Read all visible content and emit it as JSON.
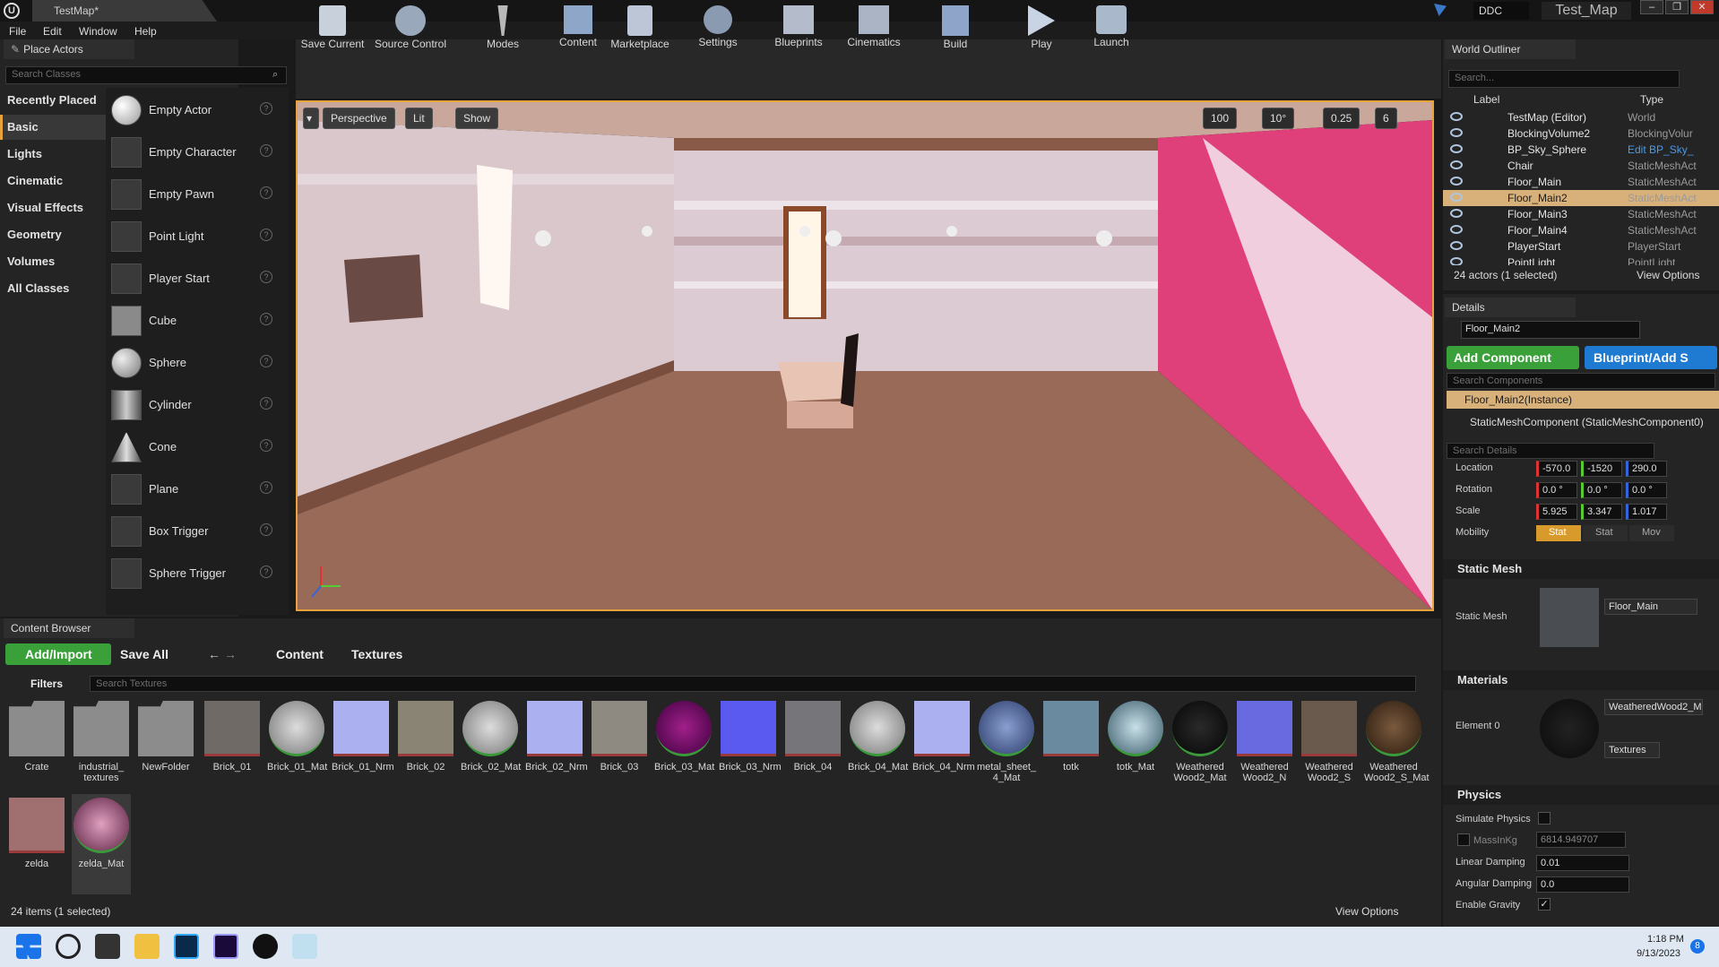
{
  "window": {
    "doc_tab": "TestMap*",
    "ddc_label": "DDC",
    "map_name": "Test_Map",
    "menus": [
      "File",
      "Edit",
      "Window",
      "Help"
    ]
  },
  "place_actors": {
    "tab_title": "Place Actors",
    "search_placeholder": "Search Classes",
    "categories": [
      "Recently Placed",
      "Basic",
      "Lights",
      "Cinematic",
      "Visual Effects",
      "Geometry",
      "Volumes",
      "All Classes"
    ],
    "selected_category": "Basic",
    "actors": [
      "Empty Actor",
      "Empty Character",
      "Empty Pawn",
      "Point Light",
      "Player Start",
      "Cube",
      "Sphere",
      "Cylinder",
      "Cone",
      "Plane",
      "Box Trigger",
      "Sphere Trigger"
    ]
  },
  "toolbar": {
    "buttons": [
      "Save Current",
      "Source Control",
      "Modes",
      "Content",
      "Marketplace",
      "Settings",
      "Blueprints",
      "Cinematics",
      "Build",
      "Play",
      "Launch"
    ]
  },
  "viewport": {
    "perspective": "Perspective",
    "lit": "Lit",
    "show": "Show",
    "grid_snap": "100",
    "rot_snap": "10°",
    "scale_snap": "0.25",
    "camera_speed": "6"
  },
  "outliner": {
    "tab_title": "World Outliner",
    "search_placeholder": "Search...",
    "col_label": "Label",
    "col_type": "Type",
    "rows": [
      {
        "name": "TestMap (Editor)",
        "type": "World"
      },
      {
        "name": "BlockingVolume2",
        "type": "BlockingVolur"
      },
      {
        "name": "BP_Sky_Sphere",
        "type": "Edit BP_Sky_"
      },
      {
        "name": "Chair",
        "type": "StaticMeshAct"
      },
      {
        "name": "Floor_Main",
        "type": "StaticMeshAct"
      },
      {
        "name": "Floor_Main2",
        "type": "StaticMeshAct"
      },
      {
        "name": "Floor_Main3",
        "type": "StaticMeshAct"
      },
      {
        "name": "Floor_Main4",
        "type": "StaticMeshAct"
      },
      {
        "name": "PlayerStart",
        "type": "PlayerStart"
      },
      {
        "name": "PointLight",
        "type": "PointLight"
      }
    ],
    "selected_row": "Floor_Main2",
    "status": "24 actors (1 selected)",
    "view_options": "View Options"
  },
  "details": {
    "tab_title": "Details",
    "actor_name": "Floor_Main2",
    "add_component": "Add Component",
    "blueprint": "Blueprint/Add S",
    "search_components": "Search Components",
    "instance": "Floor_Main2(Instance)",
    "component": "StaticMeshComponent (StaticMeshComponent0)",
    "search_details": "Search Details",
    "location_label": "Location",
    "location": [
      "-570.0",
      "-1520",
      "290.0"
    ],
    "rotation_label": "Rotation",
    "rotation": [
      "0.0 °",
      "0.0 °",
      "0.0 °"
    ],
    "scale_label": "Scale",
    "scale": [
      "5.925",
      "3.347",
      "1.017"
    ],
    "mobility_label": "Mobility",
    "mobility": [
      "Stat",
      "Stat",
      "Mov"
    ],
    "static_mesh_section": "Static Mesh",
    "static_mesh_label": "Static Mesh",
    "static_mesh_value": "Floor_Main",
    "materials_section": "Materials",
    "element0_label": "Element 0",
    "element0_value": "WeatheredWood2_M",
    "textures_dropdown": "Textures",
    "physics_section": "Physics",
    "simulate_physics": "Simulate Physics",
    "mass_label": "MassInKg",
    "mass_value": "6814.949707",
    "linear_damping_label": "Linear Damping",
    "linear_damping": "0.01",
    "angular_damping_label": "Angular Damping",
    "angular_damping": "0.0",
    "enable_gravity": "Enable Gravity"
  },
  "content_browser": {
    "tab_title": "Content Browser",
    "add_import": "Add/Import",
    "save_all": "Save All",
    "path": [
      "Content",
      "Textures"
    ],
    "filters": "Filters",
    "search_placeholder": "Search Textures",
    "folders": [
      "Crate",
      "industrial_\ntextures",
      "NewFolder"
    ],
    "assets_row1": [
      "Brick_01",
      "Brick_01_Mat",
      "Brick_01_Nrm",
      "Brick_02",
      "Brick_02_Mat",
      "Brick_02_Nrm",
      "Brick_03",
      "Brick_03_Mat",
      "Brick_03_Nrm",
      "Brick_04",
      "Brick_04_Mat",
      "Brick_04_Nrm",
      "metal_sheet_\n4_Mat",
      "totk",
      "totk_Mat",
      "Weathered\nWood2_Mat",
      "Weathered\nWood2_N",
      "Weathered\nWood2_S",
      "Weathered\nWood2_S_Mat"
    ],
    "assets_row2": [
      "zelda",
      "zelda_Mat"
    ],
    "status": "24 items (1 selected)",
    "view_options": "View Options"
  },
  "taskbar": {
    "time": "1:18 PM",
    "date": "9/13/2023",
    "notifications": "8"
  }
}
